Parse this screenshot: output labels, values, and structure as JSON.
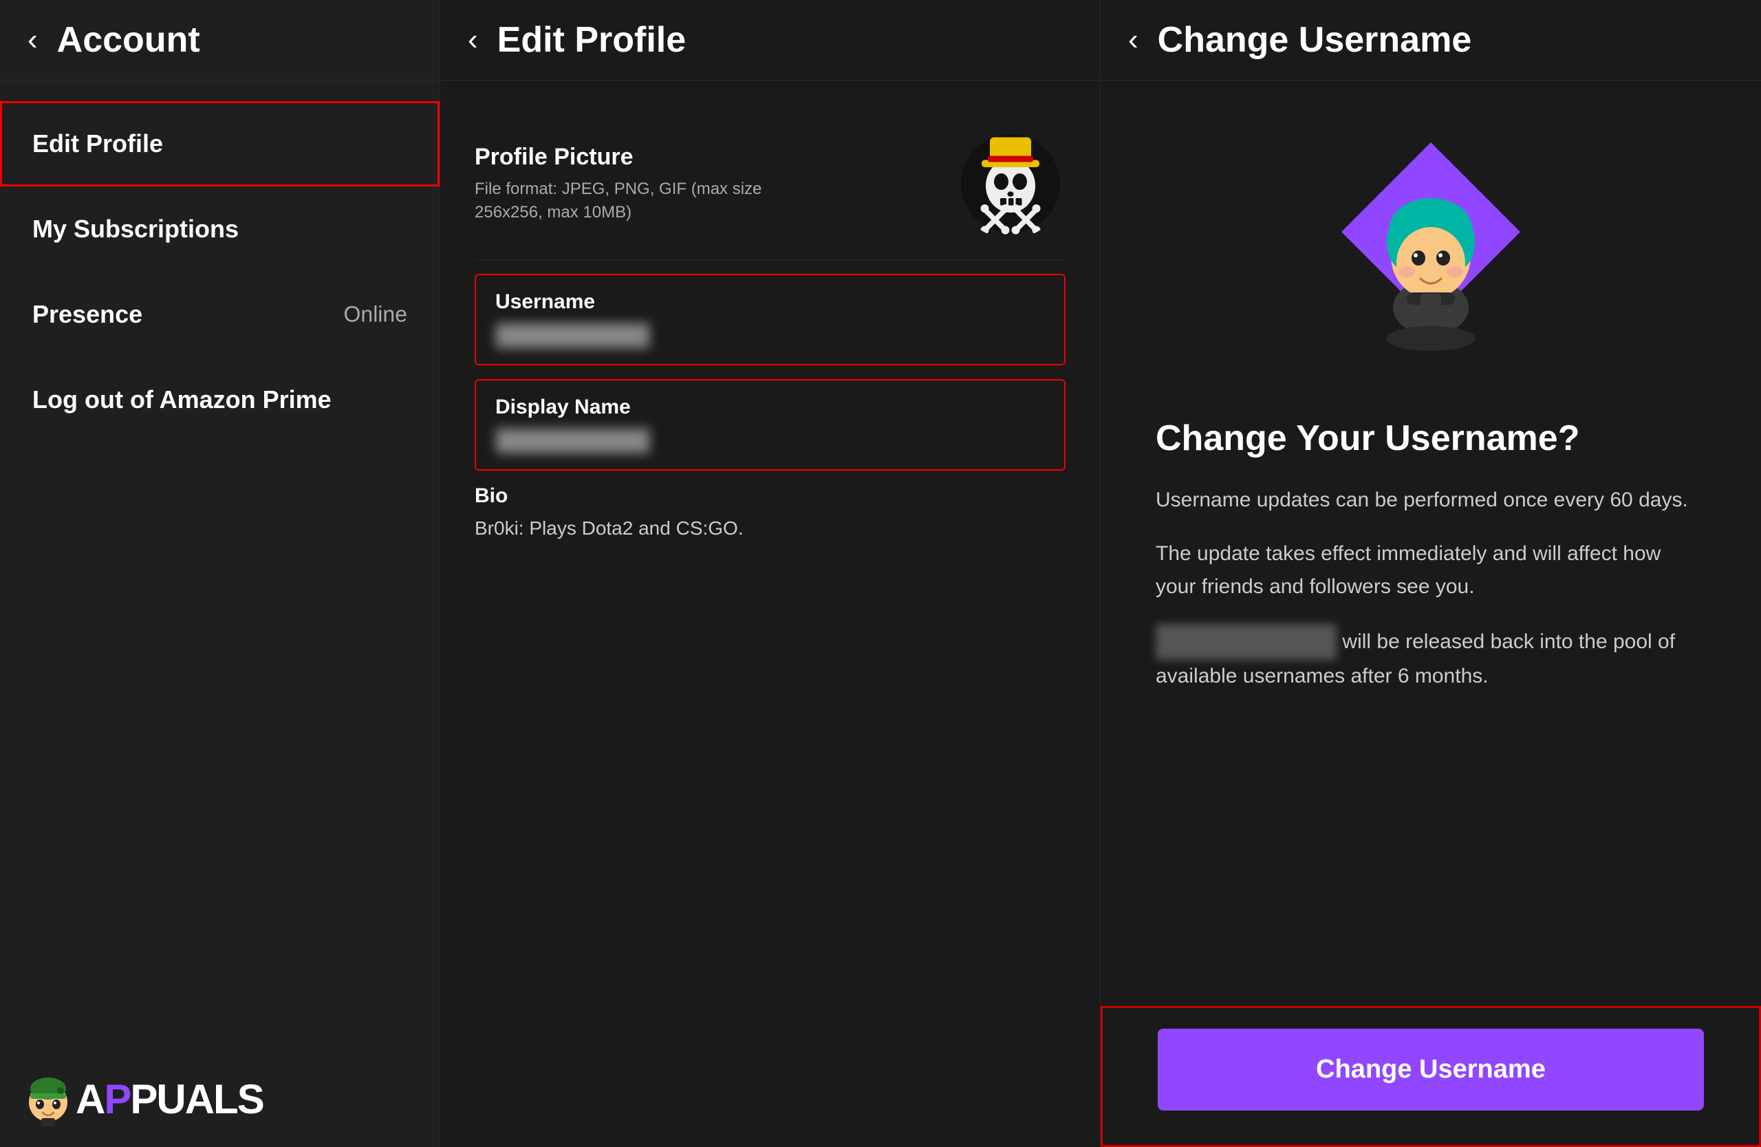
{
  "panel1": {
    "header": {
      "back_label": "‹",
      "title": "Account"
    },
    "nav": [
      {
        "id": "edit-profile",
        "label": "Edit Profile",
        "active": true,
        "status": ""
      },
      {
        "id": "my-subscriptions",
        "label": "My Subscriptions",
        "active": false,
        "status": ""
      },
      {
        "id": "presence",
        "label": "Presence",
        "active": false,
        "status": "Online"
      },
      {
        "id": "log-out-amazon",
        "label": "Log out of Amazon Prime",
        "active": false,
        "status": ""
      }
    ]
  },
  "panel2": {
    "header": {
      "back_label": "‹",
      "title": "Edit Profile"
    },
    "profile_picture": {
      "label": "Profile Picture",
      "description": "File format: JPEG, PNG, GIF (max size 256x256, max 10MB)"
    },
    "username": {
      "label": "Username",
      "value_placeholder": "████████████"
    },
    "display_name": {
      "label": "Display Name",
      "value_placeholder": "████████████"
    },
    "bio": {
      "label": "Bio",
      "value": "Br0ki: Plays Dota2 and CS:GO."
    }
  },
  "panel3": {
    "header": {
      "back_label": "‹",
      "title": "Change Username"
    },
    "change_title": "Change Your Username?",
    "desc1": "Username updates can be performed once every 60 days.",
    "desc2": "The update takes effect immediately and will affect how your friends and followers see you.",
    "desc3_prefix": "",
    "desc3_blur": "████████████",
    "desc3_suffix": " will be released back into the pool of available usernames after 6 months.",
    "button_label": "Change Username"
  },
  "watermark": {
    "text_a": "A",
    "text_puals": "PUALS"
  }
}
